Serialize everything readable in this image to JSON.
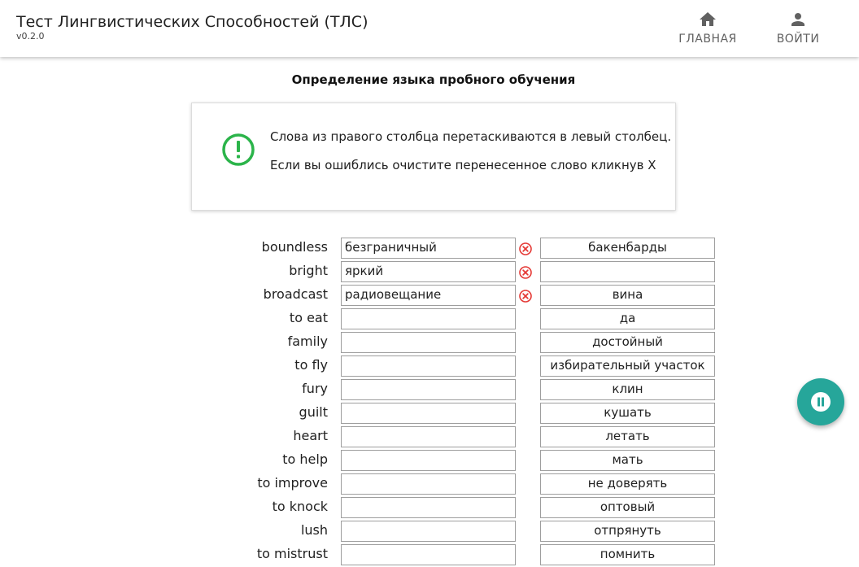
{
  "app": {
    "title": "Тест Лингвистических Способностей (ТЛС)",
    "version": "v0.2.0"
  },
  "nav": {
    "home": {
      "label": "ГЛАВНАЯ",
      "icon": "home-icon"
    },
    "login": {
      "label": "ВОЙТИ",
      "icon": "person-icon"
    }
  },
  "page": {
    "heading": "Определение языка пробного обучения"
  },
  "info": {
    "icon": "exclamation-circle-icon",
    "icon_color": "#2bb44a",
    "line1": "Слова из правого столбца перетаскиваются в левый столбец.",
    "line2": "Если вы ошиблись очистите перенесенное слово кликнув X"
  },
  "matching": {
    "clear_icon_color": "#e53935",
    "rows": [
      {
        "word": "boundless",
        "answer": "безграничный",
        "option": "бакенбарды"
      },
      {
        "word": "bright",
        "answer": "яркий",
        "option": ""
      },
      {
        "word": "broadcast",
        "answer": "радиовещание",
        "option": "вина"
      },
      {
        "word": "to eat",
        "answer": "",
        "option": "да"
      },
      {
        "word": "family",
        "answer": "",
        "option": "достойный"
      },
      {
        "word": "to fly",
        "answer": "",
        "option": "избирательный участок"
      },
      {
        "word": "fury",
        "answer": "",
        "option": "клин"
      },
      {
        "word": "guilt",
        "answer": "",
        "option": "кушать"
      },
      {
        "word": "heart",
        "answer": "",
        "option": "летать"
      },
      {
        "word": "to help",
        "answer": "",
        "option": "мать"
      },
      {
        "word": "to improve",
        "answer": "",
        "option": "не доверять"
      },
      {
        "word": "to knock",
        "answer": "",
        "option": "оптовый"
      },
      {
        "word": "lush",
        "answer": "",
        "option": "отпрянуть"
      },
      {
        "word": "to mistrust",
        "answer": "",
        "option": "помнить"
      }
    ]
  },
  "fab": {
    "icon": "pause-icon",
    "color": "#26a69a"
  }
}
